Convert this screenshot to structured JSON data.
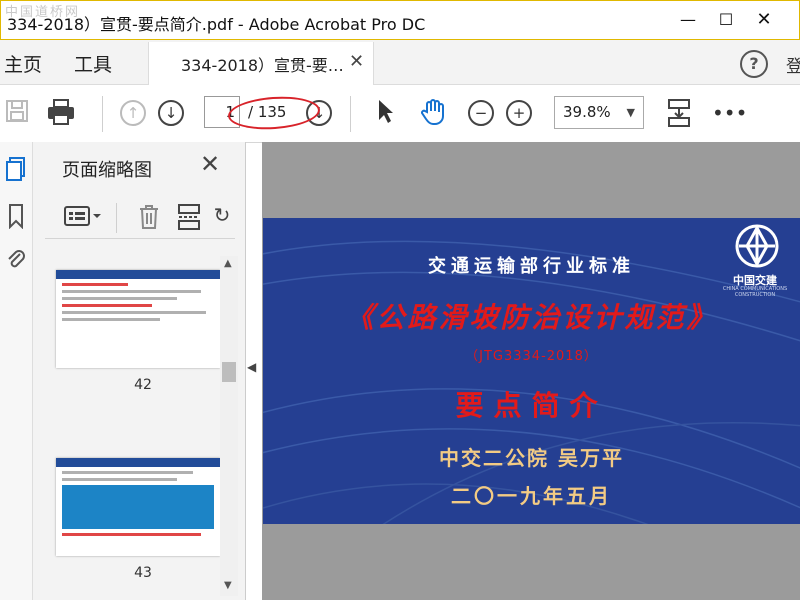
{
  "window": {
    "title": "334-2018）宣贯-要点简介.pdf - Adobe Acrobat Pro DC",
    "watermark": "中国道桥网"
  },
  "menu": {
    "home": "主页",
    "tools": "工具",
    "signin": "登"
  },
  "tab": {
    "label": "334-2018）宣贯-要…"
  },
  "toolbar": {
    "current_page": "1",
    "total_pages": "/ 135",
    "zoom": "39.8%"
  },
  "panel": {
    "title": "页面缩略图",
    "thumbnails": [
      {
        "page": "42"
      },
      {
        "page": "43"
      }
    ]
  },
  "document": {
    "standard": "交通运输部行业标准",
    "title": "《公路滑坡防治设计规范》",
    "code": "（JTG3334-2018）",
    "subtitle": "要点简介",
    "author": "中交二公院    吴万平",
    "date": "二〇一九年五月",
    "logo_text": "中国交建",
    "logo_sub": "CHINA COMMUNICATIONS CONSTRUCTION"
  },
  "colors": {
    "slide_bg": "#253f92",
    "title_red": "#e21a1a",
    "gold": "#f3cb84",
    "highlight_oval": "#d8232a"
  }
}
